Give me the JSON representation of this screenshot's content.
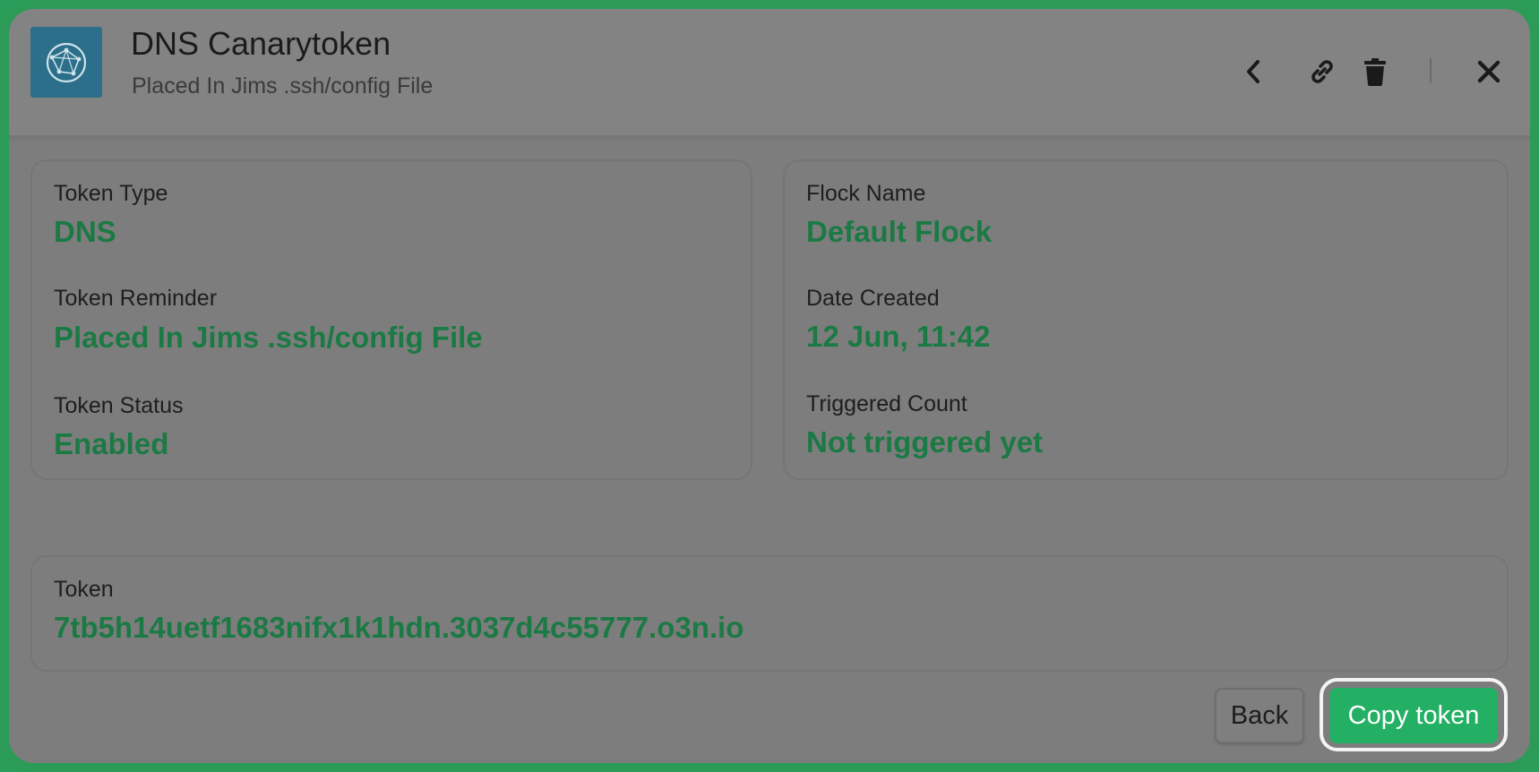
{
  "header": {
    "title": "DNS Canarytoken",
    "subtitle": "Placed In Jims .ssh/config File",
    "logo_icon": "globe-network-icon",
    "actions": [
      "back-chevron-icon",
      "link-icon",
      "trash-icon",
      "close-icon"
    ]
  },
  "details": {
    "token_type_label": "Token Type",
    "token_type_value": "DNS",
    "token_reminder_label": "Token Reminder",
    "token_reminder_value": "Placed In Jims .ssh/config File",
    "token_status_label": "Token Status",
    "token_status_value": "Enabled",
    "flock_name_label": "Flock Name",
    "flock_name_value": "Default Flock",
    "date_created_label": "Date Created",
    "date_created_value": "12 Jun, 11:42",
    "triggered_count_label": "Triggered Count",
    "triggered_count_value": "Not triggered yet"
  },
  "token": {
    "label": "Token",
    "value": "7tb5h14uetf1683nifx1k1hdn.3037d4c55777.o3n.io"
  },
  "footer": {
    "back_label": "Back",
    "copy_label": "Copy token"
  },
  "colors": {
    "accent": "#24b064",
    "value_text": "#1b7a44",
    "frame": "#2b9b57",
    "overlay": "#7d7d7d"
  }
}
